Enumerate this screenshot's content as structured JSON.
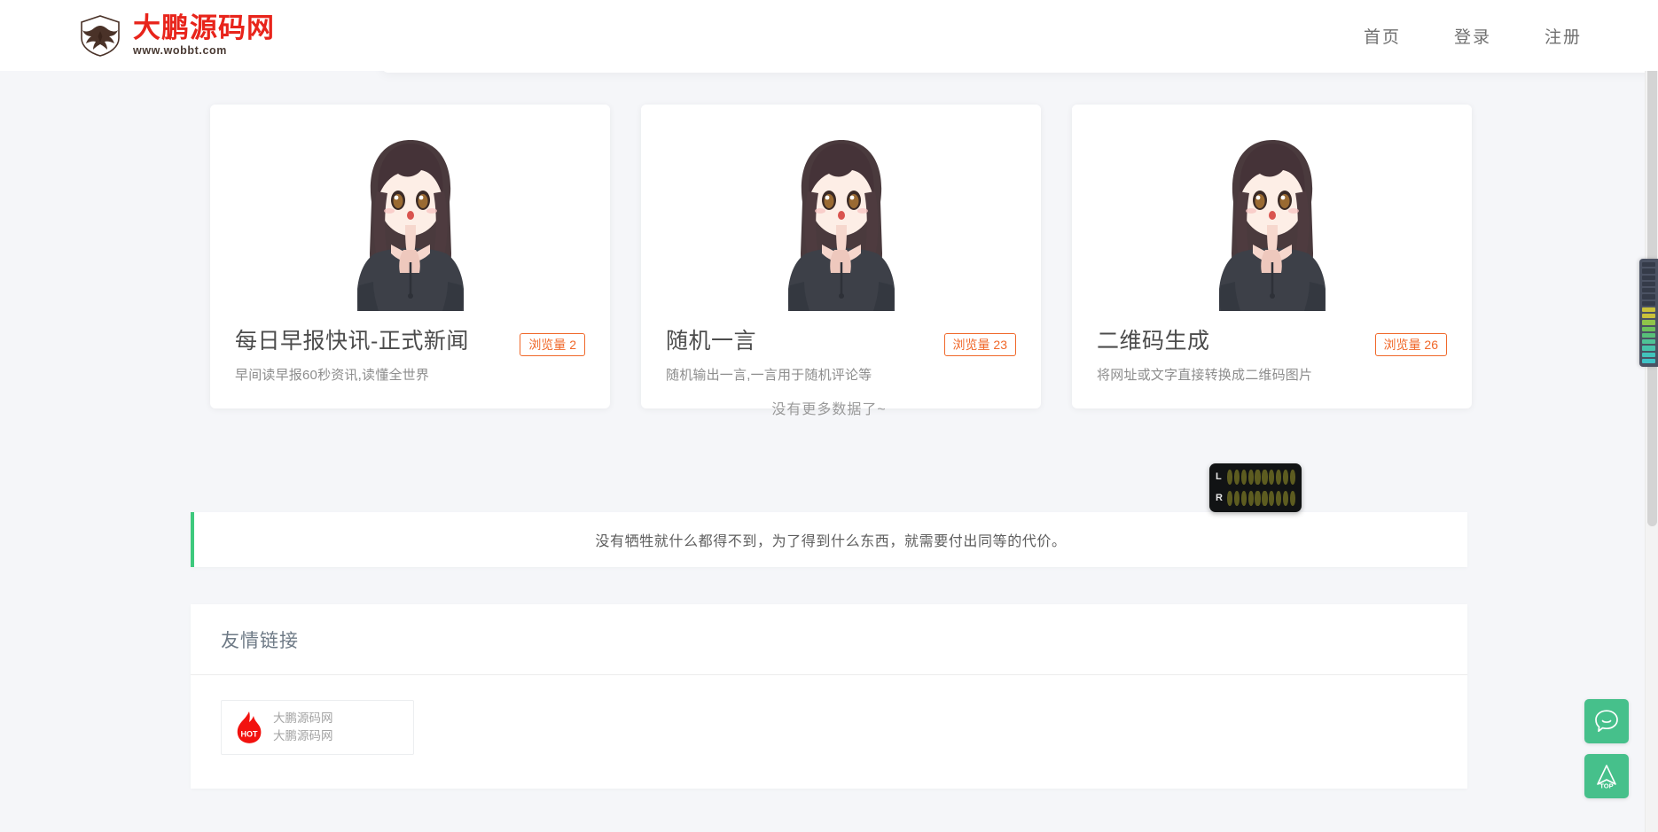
{
  "header": {
    "brand": {
      "title": "大鹏源码网",
      "url": "www.wobbt.com",
      "logo_icon": "eagle-shield-logo"
    },
    "nav": [
      {
        "label": "首页",
        "name": "nav-home"
      },
      {
        "label": "登录",
        "name": "nav-login"
      },
      {
        "label": "注册",
        "name": "nav-register"
      }
    ]
  },
  "main": {
    "cards": [
      {
        "title": "每日早报快讯-正式新闻",
        "desc": "早间读早报60秒资讯,读懂全世界",
        "badge": "浏览量 2",
        "thumb_icon": "anime-girl-illustration"
      },
      {
        "title": "随机一言",
        "desc": "随机输出一言,一言用于随机评论等",
        "badge": "浏览量 23",
        "thumb_icon": "anime-girl-illustration"
      },
      {
        "title": "二维码生成",
        "desc": "将网址或文字直接转换成二维码图片",
        "badge": "浏览量 26",
        "thumb_icon": "anime-girl-illustration"
      }
    ],
    "no_more_text": "没有更多数据了~",
    "quote": "没有牺牲就什么都得不到，为了得到什么东西，就需要付出同等的代价。"
  },
  "friend_links": {
    "title": "友情链接",
    "items": [
      {
        "name": "大鹏源码网",
        "sub": "大鹏源码网",
        "icon": "hot-flame-icon",
        "icon_label": "HOT"
      }
    ]
  },
  "widgets": {
    "audio_meter": {
      "left_label": "L",
      "right_label": "R",
      "segments": 10
    },
    "vertical_meter": {
      "segments": 16
    },
    "fabs": [
      {
        "name": "feedback-button",
        "icon": "smiley-chat-icon",
        "label": ""
      },
      {
        "name": "back-to-top-button",
        "icon": "arrow-up-icon",
        "label": "TOP"
      }
    ]
  },
  "colors": {
    "brand_red": "#e8241b",
    "accent_green": "#46c08b",
    "badge_orange": "#f0682a",
    "quote_bar_green": "#3ec97d",
    "page_bg": "#f5f6f9"
  }
}
